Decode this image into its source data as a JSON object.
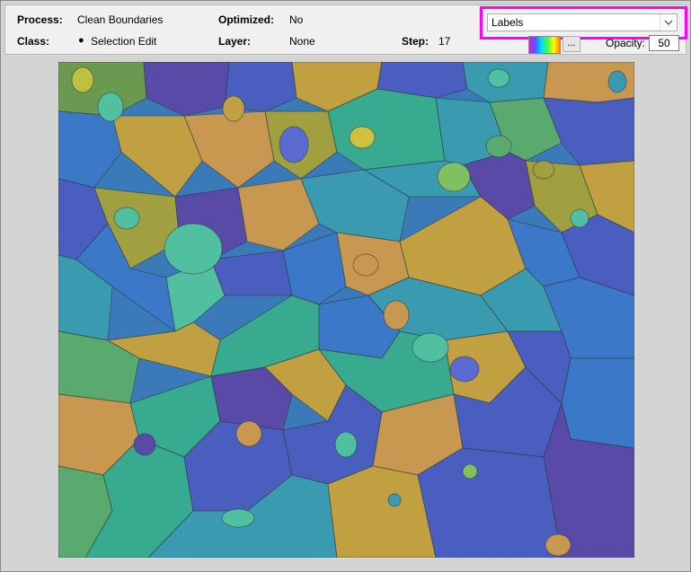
{
  "toolbar": {
    "process_label": "Process:",
    "process_value": "Clean Boundaries",
    "optimized_label": "Optimized:",
    "optimized_value": "No",
    "class_label": "Class:",
    "class_bullet": "●",
    "class_value": "Selection Edit",
    "layer_label": "Layer:",
    "layer_value": "None",
    "step_label": "Step:",
    "step_value": "17",
    "view_dropdown_value": "Labels",
    "colormap_button_label": "...",
    "opacity_label": "Opacity:",
    "opacity_value": "50"
  },
  "colors": {
    "highlight": "#ff00ff",
    "label_palette": [
      "#4a5ec0",
      "#3c78c8",
      "#3a9ab0",
      "#38aa90",
      "#5aaa70",
      "#6a9a50",
      "#a0a040",
      "#c0a040",
      "#c89850",
      "#5a4aa8",
      "#50c0a0",
      "#80c060"
    ]
  },
  "icons": {
    "dropdown": "chevron-down-icon",
    "colormap": "colormap-gradient-icon"
  }
}
